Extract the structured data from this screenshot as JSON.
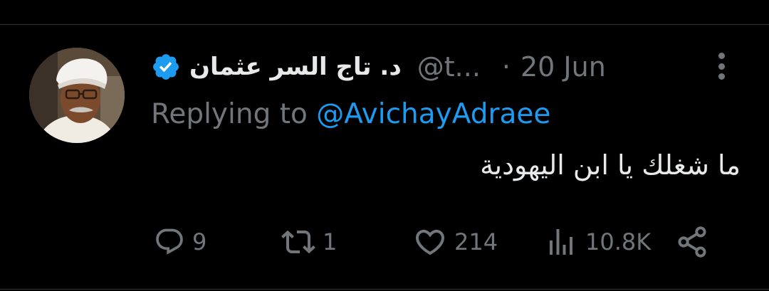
{
  "tweet": {
    "display_name": "د. تاج السر عثمان",
    "handle": "@t...",
    "separator": "·",
    "date": "20 Jun",
    "replying_prefix": "Replying to",
    "replying_to": "@AvichayAdraee",
    "text": "ما شغلك يا ابن اليهودية",
    "verified": true,
    "avatar": "profile-photo"
  },
  "actions": {
    "replies": {
      "icon": "reply-icon",
      "count": "9"
    },
    "retweets": {
      "icon": "retweet-icon",
      "count": "1"
    },
    "likes": {
      "icon": "heart-icon",
      "count": "214"
    },
    "views": {
      "icon": "views-icon",
      "count": "10.8K"
    },
    "share": {
      "icon": "share-icon"
    }
  },
  "colors": {
    "background": "#000000",
    "text": "#e7e9ea",
    "muted": "#71767b",
    "accent": "#1d9bf0",
    "divider": "#2f3336"
  }
}
